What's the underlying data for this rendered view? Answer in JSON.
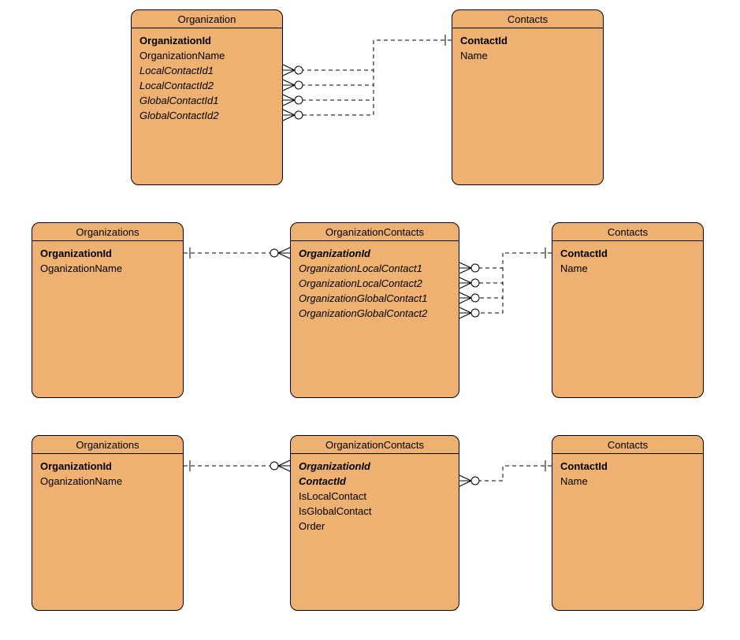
{
  "entities": {
    "r1e1": {
      "title": "Organization",
      "fields": [
        {
          "text": "OrganizationId",
          "style": "bold"
        },
        {
          "text": "OrganizationName",
          "style": ""
        },
        {
          "text": "LocalContactId1",
          "style": "italic"
        },
        {
          "text": "LocalContactId2",
          "style": "italic"
        },
        {
          "text": "GlobalContactId1",
          "style": "italic"
        },
        {
          "text": "GlobalContactId2",
          "style": "italic"
        }
      ]
    },
    "r1e2": {
      "title": "Contacts",
      "fields": [
        {
          "text": "ContactId",
          "style": "bold"
        },
        {
          "text": "Name",
          "style": ""
        }
      ]
    },
    "r2e1": {
      "title": "Organizations",
      "fields": [
        {
          "text": "OrganizationId",
          "style": "bold"
        },
        {
          "text": "OganizationName",
          "style": ""
        }
      ]
    },
    "r2e2": {
      "title": "OrganizationContacts",
      "fields": [
        {
          "text": "OrganizationId",
          "style": "bolditalic"
        },
        {
          "text": "OrganizationLocalContact1",
          "style": "italic"
        },
        {
          "text": "OrganizationLocalContact2",
          "style": "italic"
        },
        {
          "text": "OrganizationGlobalContact1",
          "style": "italic"
        },
        {
          "text": "OrganizationGlobalContact2",
          "style": "italic"
        }
      ]
    },
    "r2e3": {
      "title": "Contacts",
      "fields": [
        {
          "text": "ContactId",
          "style": "bold"
        },
        {
          "text": "Name",
          "style": ""
        }
      ]
    },
    "r3e1": {
      "title": "Organizations",
      "fields": [
        {
          "text": "OrganizationId",
          "style": "bold"
        },
        {
          "text": "OganizationName",
          "style": ""
        }
      ]
    },
    "r3e2": {
      "title": "OrganizationContacts",
      "fields": [
        {
          "text": "OrganizationId",
          "style": "bolditalic"
        },
        {
          "text": "ContactId",
          "style": "bolditalic"
        },
        {
          "text": "IsLocalContact",
          "style": ""
        },
        {
          "text": "IsGlobalContact",
          "style": ""
        },
        {
          "text": "Order",
          "style": ""
        }
      ]
    },
    "r3e3": {
      "title": "Contacts",
      "fields": [
        {
          "text": "ContactId",
          "style": "bold"
        },
        {
          "text": "Name",
          "style": ""
        }
      ]
    }
  },
  "chart_data": {
    "type": "table",
    "description": "Entity-Relationship diagram showing three alternative schema designs for Organization-Contact relationships",
    "rows": [
      {
        "design": 1,
        "entities": [
          "Organization",
          "Contacts"
        ],
        "relationships": [
          {
            "from": "Organization.LocalContactId1",
            "to": "Contacts.ContactId",
            "cardinality": "many-to-one-optional"
          },
          {
            "from": "Organization.LocalContactId2",
            "to": "Contacts.ContactId",
            "cardinality": "many-to-one-optional"
          },
          {
            "from": "Organization.GlobalContactId1",
            "to": "Contacts.ContactId",
            "cardinality": "many-to-one-optional"
          },
          {
            "from": "Organization.GlobalContactId2",
            "to": "Contacts.ContactId",
            "cardinality": "many-to-one-optional"
          }
        ]
      },
      {
        "design": 2,
        "entities": [
          "Organizations",
          "OrganizationContacts",
          "Contacts"
        ],
        "relationships": [
          {
            "from": "Organizations.OrganizationId",
            "to": "OrganizationContacts.OrganizationId",
            "cardinality": "one-to-many-optional"
          },
          {
            "from": "OrganizationContacts.OrganizationLocalContact1",
            "to": "Contacts.ContactId",
            "cardinality": "many-to-one-optional"
          },
          {
            "from": "OrganizationContacts.OrganizationLocalContact2",
            "to": "Contacts.ContactId",
            "cardinality": "many-to-one-optional"
          },
          {
            "from": "OrganizationContacts.OrganizationGlobalContact1",
            "to": "Contacts.ContactId",
            "cardinality": "many-to-one-optional"
          },
          {
            "from": "OrganizationContacts.OrganizationGlobalContact2",
            "to": "Contacts.ContactId",
            "cardinality": "many-to-one-optional"
          }
        ]
      },
      {
        "design": 3,
        "entities": [
          "Organizations",
          "OrganizationContacts",
          "Contacts"
        ],
        "relationships": [
          {
            "from": "Organizations.OrganizationId",
            "to": "OrganizationContacts.OrganizationId",
            "cardinality": "one-to-many-optional"
          },
          {
            "from": "OrganizationContacts.ContactId",
            "to": "Contacts.ContactId",
            "cardinality": "many-to-one-optional"
          }
        ]
      }
    ]
  }
}
